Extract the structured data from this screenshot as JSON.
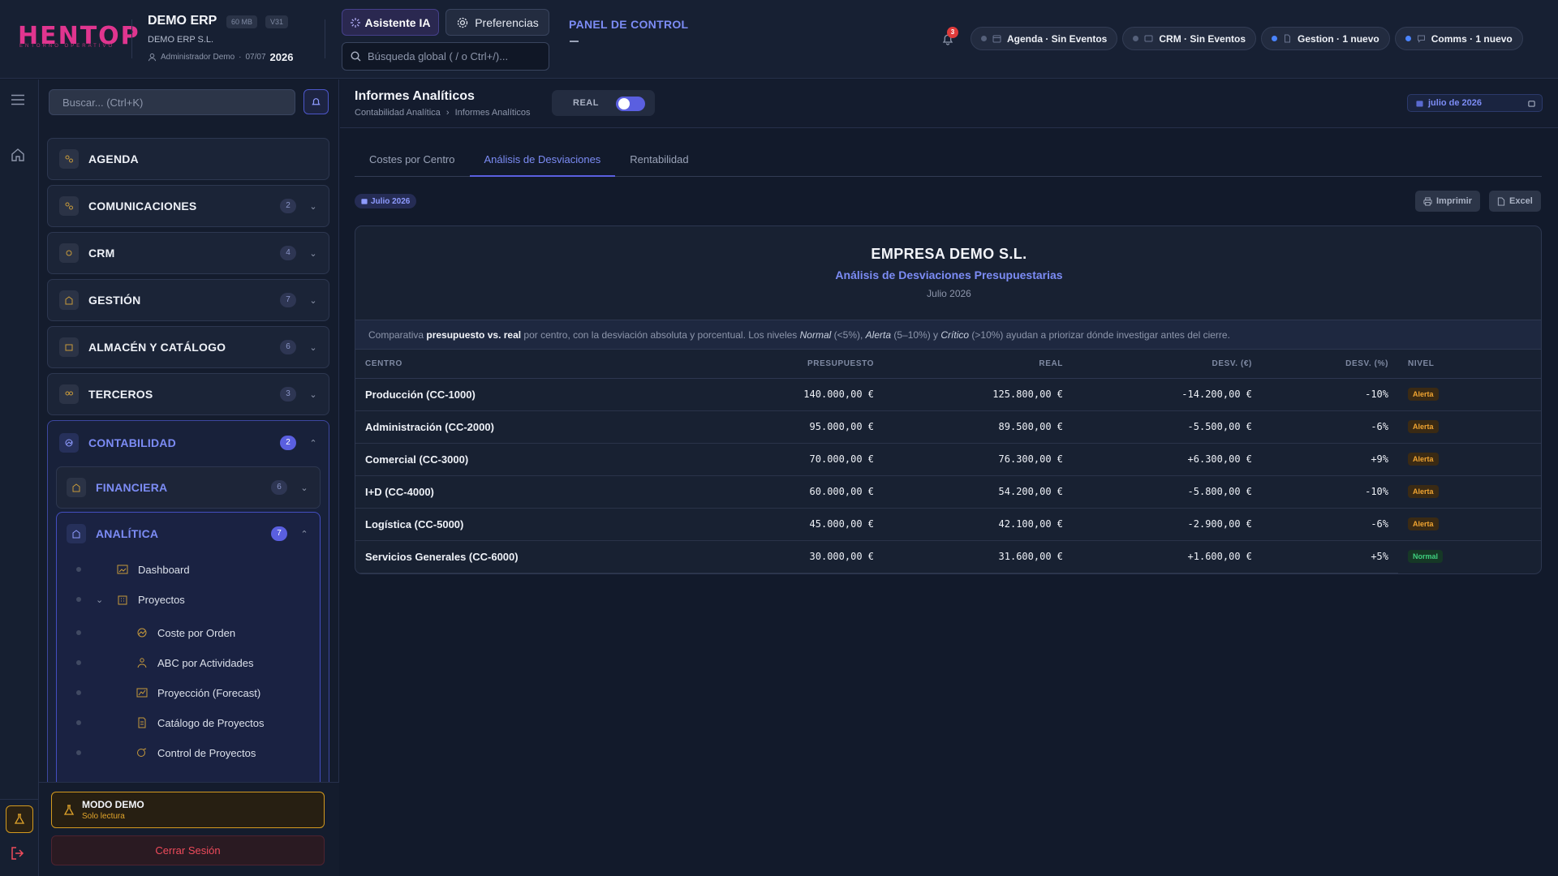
{
  "header": {
    "logo_text": "HENTOP",
    "logo_sub": "ENTORNO OPERATIVO",
    "app_name": "DEMO ERP",
    "tag_mb": "60 MB",
    "tag_ver": "V31",
    "company": "DEMO ERP S.L.",
    "user": "Administrador Demo",
    "date_short": "07/07",
    "year": "2026",
    "ai_button": "Asistente IA",
    "prefs_button": "Preferencias",
    "search_placeholder": "Búsqueda global ( / o Ctrl+/)...",
    "panel_title": "PANEL DE CONTROL",
    "notif_count": "3",
    "chips": [
      {
        "label": "Agenda · Sin Eventos",
        "active": false,
        "icon": "calendar-icon"
      },
      {
        "label": "CRM · Sin Eventos",
        "active": false,
        "icon": "card-icon"
      },
      {
        "label": "Gestion · 1 nuevo",
        "active": true,
        "icon": "document-icon"
      },
      {
        "label": "Comms · 1 nuevo",
        "active": true,
        "icon": "chat-icon"
      }
    ]
  },
  "sidebar": {
    "search_placeholder": "Buscar... (Ctrl+K)",
    "items": [
      {
        "label": "AGENDA",
        "badge": ""
      },
      {
        "label": "COMUNICACIONES",
        "badge": "2"
      },
      {
        "label": "CRM",
        "badge": "4"
      },
      {
        "label": "GESTIÓN",
        "badge": "7"
      },
      {
        "label": "ALMACÉN Y CATÁLOGO",
        "badge": "6"
      },
      {
        "label": "TERCEROS",
        "badge": "3"
      }
    ],
    "contabilidad": {
      "label": "CONTABILIDAD",
      "badge": "2"
    },
    "financiera": {
      "label": "FINANCIERA",
      "badge": "6"
    },
    "analitica": {
      "label": "ANALÍTICA",
      "badge": "7"
    },
    "leaves": [
      "Dashboard",
      "Proyectos",
      "Coste por Orden",
      "ABC por Actividades",
      "Proyección (Forecast)",
      "Catálogo de Proyectos",
      "Control de Proyectos"
    ],
    "demo_title": "MODO DEMO",
    "demo_sub": "Solo lectura",
    "logout": "Cerrar Sesión"
  },
  "main": {
    "title": "Informes Analíticos",
    "crumb_1": "Contabilidad Analítica",
    "crumb_sep": "›",
    "crumb_2": "Informes Analíticos",
    "toggle_label": "REAL",
    "toggle_on": true,
    "date_picker": "julio de 2026",
    "tabs": [
      "Costes por Centro",
      "Análisis de Desviaciones",
      "Rentabilidad"
    ],
    "active_tab": 1,
    "period_pill": "Julio 2026",
    "print": "Imprimir",
    "excel": "Excel"
  },
  "report": {
    "company": "EMPRESA DEMO S.L.",
    "subtitle": "Análisis de Desviaciones Presupuestarias",
    "period": "Julio 2026",
    "note_1": "Comparativa ",
    "note_b": "presupuesto vs. real",
    "note_2": " por centro, con la desviación absoluta y porcentual. Los niveles ",
    "note_i1": "Normal",
    "note_3": " (<5%), ",
    "note_i2": "Alerta",
    "note_4": " (5–10%) y ",
    "note_i3": "Crítico",
    "note_5": " (>10%) ayudan a priorizar dónde investigar antes del cierre.",
    "columns": [
      "CENTRO",
      "PRESUPUESTO",
      "REAL",
      "DESV. (€)",
      "DESV. (%)",
      "NIVEL"
    ],
    "rows": [
      [
        "Producción (CC-1000)",
        "140.000,00 €",
        "125.800,00 €",
        "-14.200,00 €",
        "-10%",
        "Alerta"
      ],
      [
        "Administración (CC-2000)",
        "95.000,00 €",
        "89.500,00 €",
        "-5.500,00 €",
        "-6%",
        "Alerta"
      ],
      [
        "Comercial (CC-3000)",
        "70.000,00 €",
        "76.300,00 €",
        "+6.300,00 €",
        "+9%",
        "Alerta"
      ],
      [
        "I+D (CC-4000)",
        "60.000,00 €",
        "54.200,00 €",
        "-5.800,00 €",
        "-10%",
        "Alerta"
      ],
      [
        "Logística (CC-5000)",
        "45.000,00 €",
        "42.100,00 €",
        "-2.900,00 €",
        "-6%",
        "Alerta"
      ],
      [
        "Servicios Generales (CC-6000)",
        "30.000,00 €",
        "31.600,00 €",
        "+1.600,00 €",
        "+5%",
        "Normal"
      ]
    ]
  },
  "colors": {
    "accent": "#5a5fe0",
    "accent_text": "#7c8cf5",
    "alert": "#f0a431",
    "normal": "#3fd07f",
    "danger": "#ef4b5b",
    "brand": "#e0358f"
  }
}
